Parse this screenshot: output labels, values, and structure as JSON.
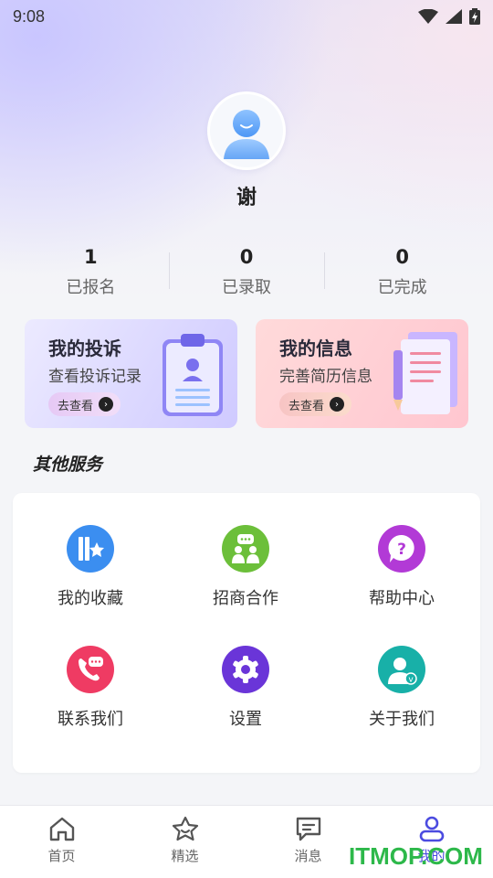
{
  "status": {
    "time": "9:08"
  },
  "profile": {
    "name": "谢"
  },
  "stats": [
    {
      "value": "1",
      "label": "已报名"
    },
    {
      "value": "0",
      "label": "已录取"
    },
    {
      "value": "0",
      "label": "已完成"
    }
  ],
  "cards": {
    "complaint": {
      "title": "我的投诉",
      "subtitle": "查看投诉记录",
      "button": "去查看"
    },
    "info": {
      "title": "我的信息",
      "subtitle": "完善简历信息",
      "button": "去查看"
    }
  },
  "section": {
    "title": "其他服务"
  },
  "services": [
    {
      "label": "我的收藏",
      "icon": "favorites-icon",
      "color": "#3b8ef0"
    },
    {
      "label": "招商合作",
      "icon": "cooperation-icon",
      "color": "#6cbf3a"
    },
    {
      "label": "帮助中心",
      "icon": "help-icon",
      "color": "#b23ad6"
    },
    {
      "label": "联系我们",
      "icon": "phone-chat-icon",
      "color": "#ef3b63"
    },
    {
      "label": "设置",
      "icon": "gear-icon",
      "color": "#6a35d8"
    },
    {
      "label": "关于我们",
      "icon": "about-user-icon",
      "color": "#18b0a8"
    }
  ],
  "tabs": [
    {
      "label": "首页",
      "icon": "home-icon",
      "active": false
    },
    {
      "label": "精选",
      "icon": "star-icon",
      "active": false
    },
    {
      "label": "消息",
      "icon": "message-icon",
      "active": false
    },
    {
      "label": "我的",
      "icon": "user-icon",
      "active": true
    }
  ],
  "watermark": "ITMOP.COM"
}
